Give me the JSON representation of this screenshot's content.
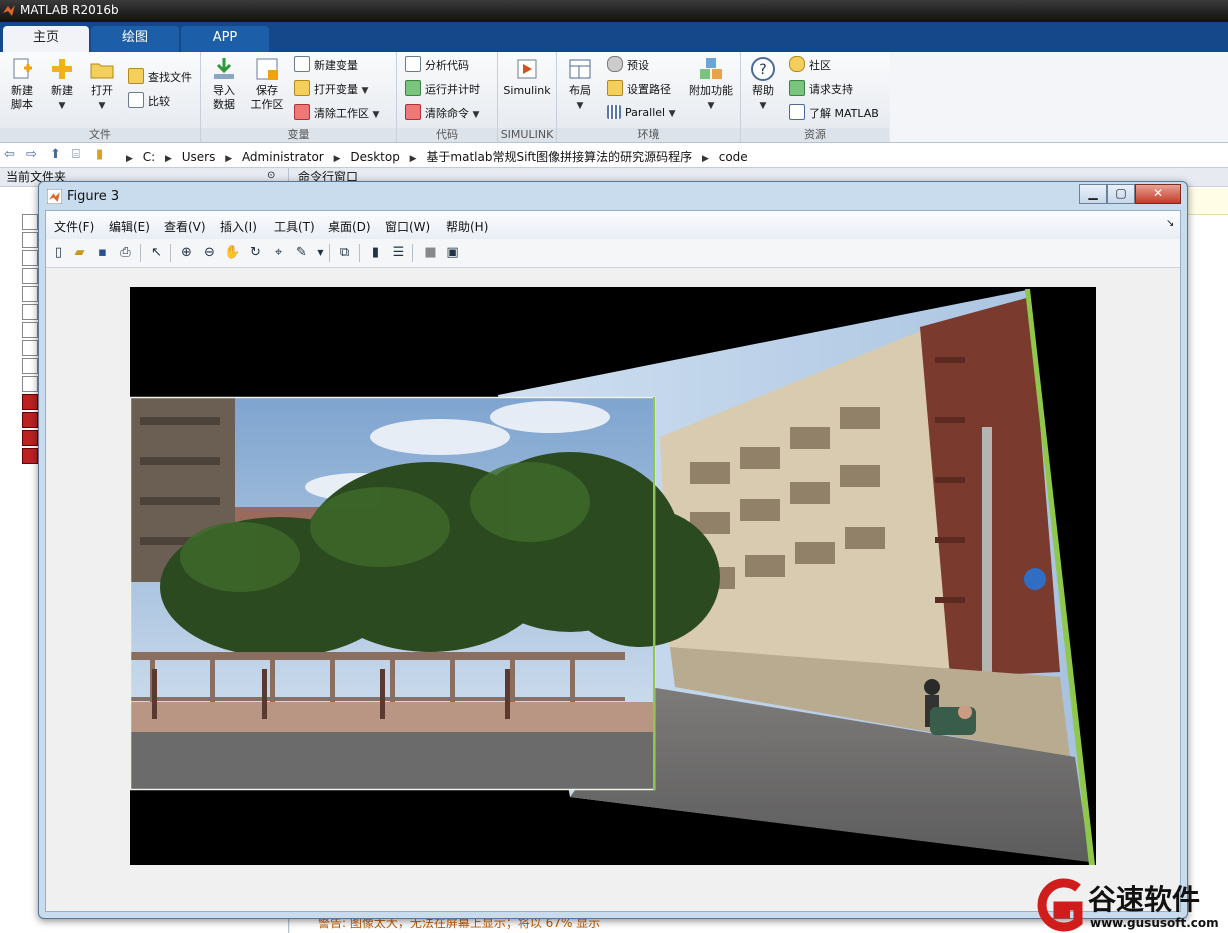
{
  "app": {
    "title": "MATLAB R2016b"
  },
  "tabs": [
    {
      "label": "主页"
    },
    {
      "label": "绘图"
    },
    {
      "label": "APP"
    }
  ],
  "ribbon": {
    "file": {
      "label": "文件",
      "new_script": "新建\n脚本",
      "new": "新建",
      "open": "打开",
      "find_files": "查找文件",
      "compare": "比较"
    },
    "variable": {
      "label": "变量",
      "import": "导入\n数据",
      "save_workspace": "保存\n工作区",
      "new_variable": "新建变量",
      "open_variable": "打开变量",
      "clear_workspace": "清除工作区"
    },
    "code": {
      "label": "代码",
      "analyze": "分析代码",
      "run_time": "运行并计时",
      "clear_commands": "清除命令"
    },
    "simulink": {
      "label": "SIMULINK",
      "button": "Simulink"
    },
    "environment": {
      "label": "环境",
      "layout": "布局",
      "preferences": "预设",
      "set_path": "设置路径",
      "parallel": "Parallel",
      "addons": "附加功能"
    },
    "resources": {
      "label": "资源",
      "help": "帮助",
      "community": "社区",
      "support": "请求支持",
      "learn": "了解 MATLAB"
    }
  },
  "path": {
    "segments": [
      "C:",
      "Users",
      "Administrator",
      "Desktop",
      "基于matlab常规Sift图像拼接算法的研究源码程序",
      "code"
    ]
  },
  "panels": {
    "current_folder": "当前文件夹",
    "command_window": "命令行窗口",
    "warning": "警告: 图像太大，无法在屏幕上显示；将以 67% 显示"
  },
  "figure": {
    "title": "Figure 3",
    "menu": [
      "文件(F)",
      "编辑(E)",
      "查看(V)",
      "插入(I)",
      "工具(T)",
      "桌面(D)",
      "窗口(W)",
      "帮助(H)"
    ],
    "toolbar_icons": [
      "new-figure-icon",
      "open-file-icon",
      "save-icon",
      "print-icon",
      "select-arrow-icon",
      "zoom-in-icon",
      "zoom-out-icon",
      "pan-icon",
      "rotate-3d-icon",
      "data-cursor-icon",
      "brush-icon",
      "link-plot-icon",
      "colorbar-icon",
      "legend-icon",
      "hide-plot-tools-icon",
      "show-plot-tools-icon"
    ]
  },
  "watermark": {
    "brand": "谷速软件",
    "url": "www.gususoft.com"
  },
  "colors": {
    "tabs_bg": "#14488a",
    "tab_active": "#f1f3f6",
    "seam_green": "#8fc74a",
    "warning_text": "#c55a00"
  }
}
